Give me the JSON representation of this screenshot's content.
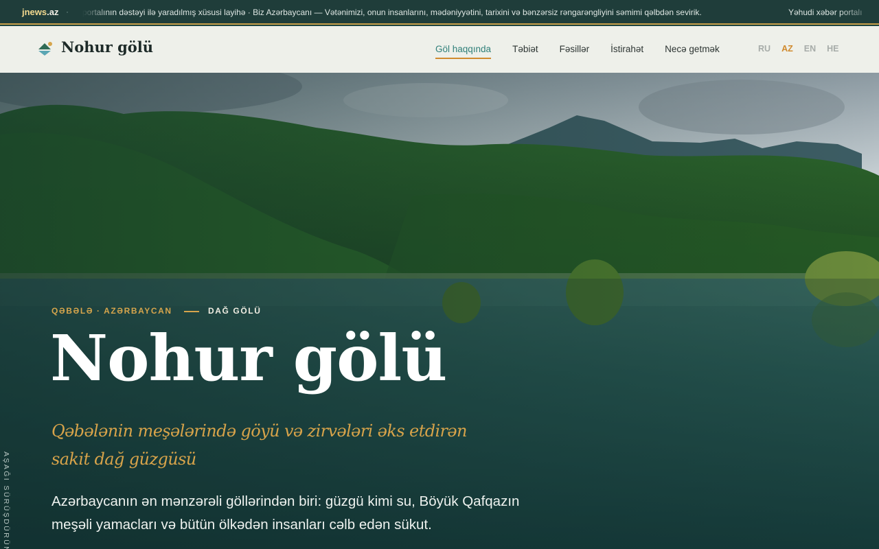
{
  "ticker": {
    "brand_name": "jnews",
    "brand_tld": ".az",
    "separator": "·",
    "message": "portalının dəstəyi ilə yaradılmış xüsusi layihə · Biz Azərbaycanı — Vətənimizi, onun insanlarını, mədəniyyətini, tarixini və bənzərsiz rəngarəngliyini səmimi qəlbdən sevirik.",
    "right_message": "Yəhudi xəbər portalı"
  },
  "header": {
    "logo_label": "Nohur gölü",
    "nav": [
      {
        "label": "Göl haqqında",
        "active": true
      },
      {
        "label": "Təbiət",
        "active": false
      },
      {
        "label": "Fəsillər",
        "active": false
      },
      {
        "label": "İstirahət",
        "active": false
      },
      {
        "label": "Necə getmək",
        "active": false
      }
    ],
    "languages": [
      {
        "code": "RU",
        "current": false
      },
      {
        "code": "AZ",
        "current": true
      },
      {
        "code": "EN",
        "current": false
      },
      {
        "code": "HE",
        "current": false
      }
    ]
  },
  "hero": {
    "eyebrow_location": "QƏBƏLƏ · AZƏRBAYCAN",
    "eyebrow_type": "DAĞ GÖLÜ",
    "title": "Nohur gölü",
    "subtitle": "Qəbələnin meşələrində göyü və zirvələri əks etdirən sakit dağ güzgüsü",
    "description": "Azərbaycanın ən mənzərəli göllərindən biri: güzgü kimi su, Böyük Qafqazın meşəli yamacları və bütün ölkədən insanları cəlb edən sükut.",
    "scroll_hint": "AŞAĞI SÜRÜŞDÜRÜN"
  },
  "colors": {
    "accent_gold": "#d08a2e",
    "accent_teal": "#2f7f79",
    "ticker_bg": "#1f3d3a",
    "header_bg": "#eef0ea"
  }
}
